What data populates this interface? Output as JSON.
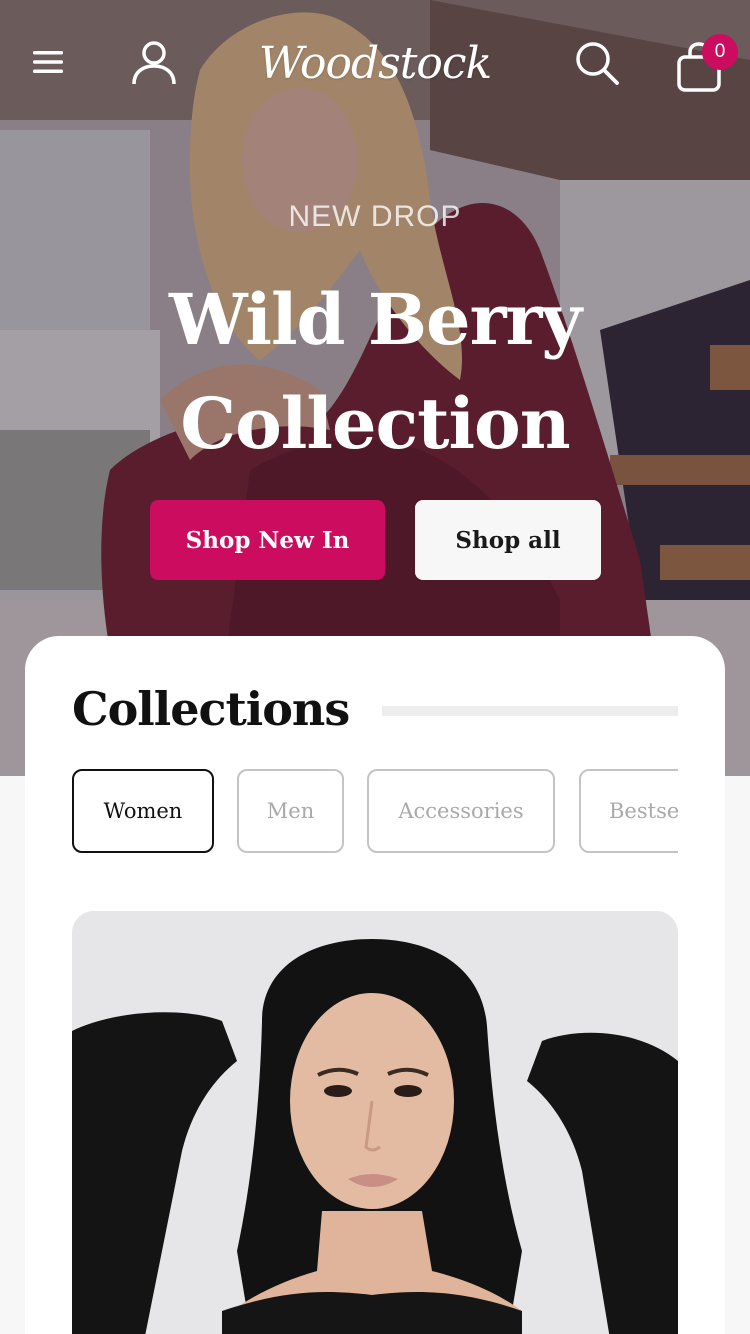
{
  "brand": {
    "logo_text": "Woodstock",
    "accent_color": "#cc0c5f"
  },
  "header": {
    "menu_icon": "menu-icon",
    "account_icon": "user-icon",
    "search_icon": "search-icon",
    "cart_icon": "shopping-bag-icon",
    "cart_count": "0"
  },
  "hero": {
    "eyebrow": "NEW DROP",
    "title_line1": "Wild Berry",
    "title_line2": "Collection",
    "primary_button": "Shop New In",
    "secondary_button": "Shop all"
  },
  "collections": {
    "title": "Collections",
    "tabs": [
      {
        "label": "Women",
        "active": true
      },
      {
        "label": "Men",
        "active": false
      },
      {
        "label": "Accessories",
        "active": false
      },
      {
        "label": "Bestsellers",
        "active": false
      }
    ]
  }
}
